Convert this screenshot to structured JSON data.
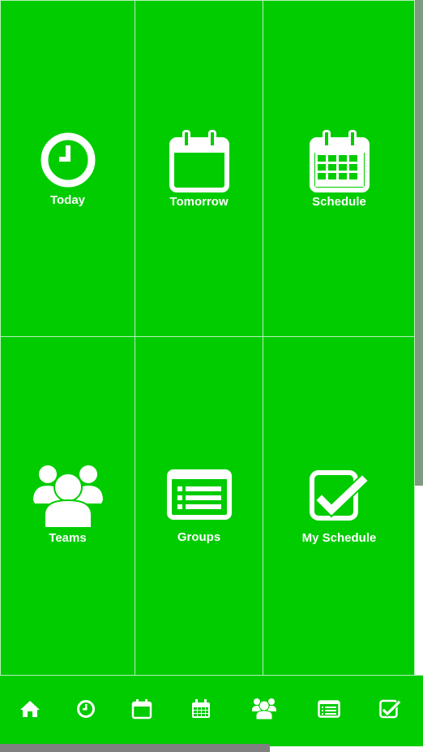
{
  "tiles": [
    {
      "label": "Today",
      "icon": "clock-icon"
    },
    {
      "label": "Tomorrow",
      "icon": "calendar-icon"
    },
    {
      "label": "Schedule",
      "icon": "calendar-grid-icon"
    },
    {
      "label": "Teams",
      "icon": "users-icon"
    },
    {
      "label": "Groups",
      "icon": "list-icon"
    },
    {
      "label": "My Schedule",
      "icon": "checkbox-icon"
    }
  ],
  "bottom_nav": [
    {
      "icon": "home-icon"
    },
    {
      "icon": "clock-icon"
    },
    {
      "icon": "calendar-icon"
    },
    {
      "icon": "calendar-grid-icon"
    },
    {
      "icon": "users-icon"
    },
    {
      "icon": "list-icon"
    },
    {
      "icon": "checkbox-icon"
    }
  ],
  "colors": {
    "background": "#00cc00",
    "grid_line": "#b8f0b8",
    "icon": "#ffffff",
    "scrollbar": "#808080"
  }
}
